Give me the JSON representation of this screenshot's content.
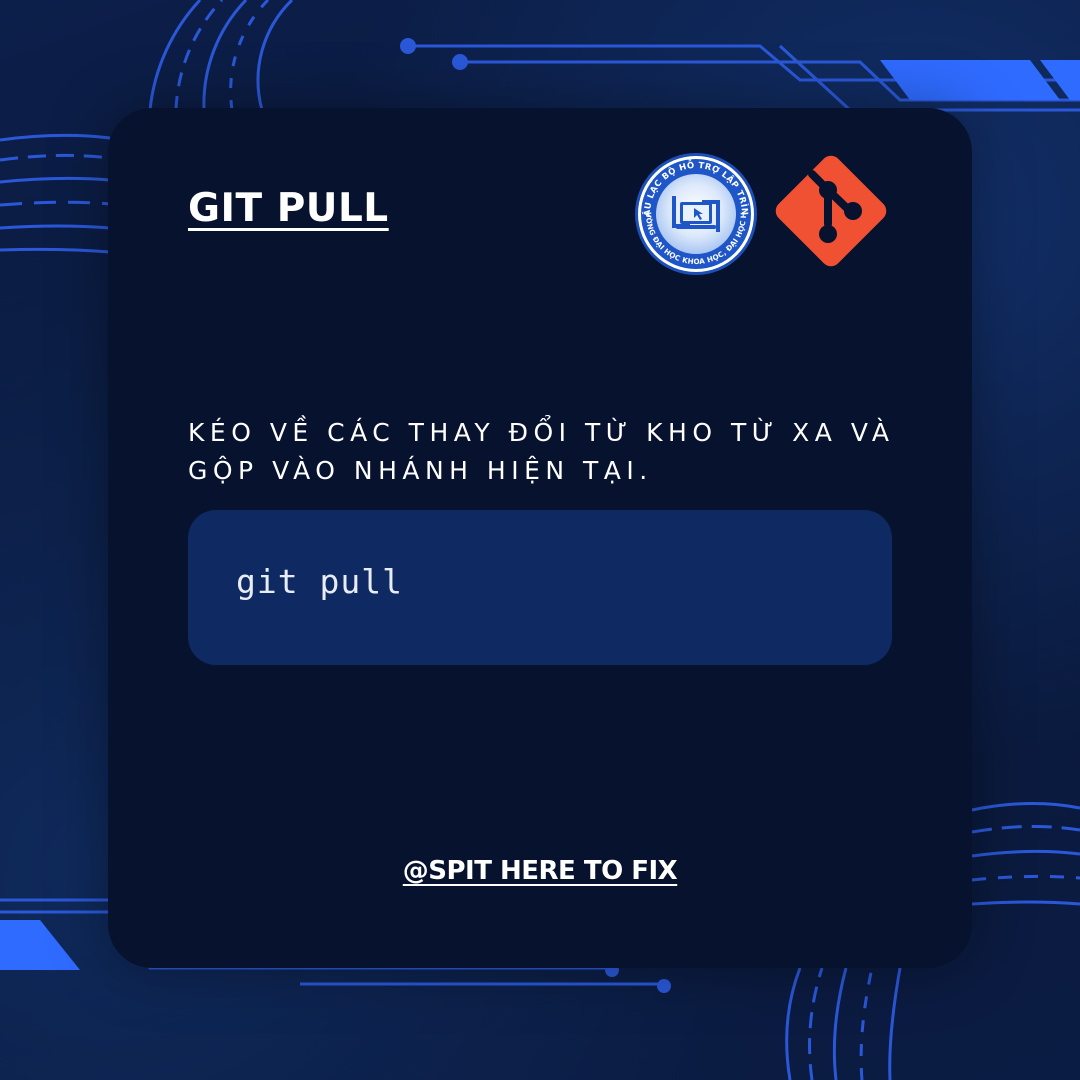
{
  "card": {
    "title": "GIT PULL",
    "description": "KÉO VỀ CÁC THAY ĐỔI TỪ KHO TỪ XA VÀ GỘP VÀO NHÁNH HIỆN TẠI.",
    "command": "git pull",
    "footer_handle": "@SPIT HERE TO FIX"
  },
  "logos": {
    "club": {
      "ring_text_top": "CÂU LẠC BỘ HỖ TRỢ LẬP TRÌNH",
      "ring_text_bottom": "TRƯỜNG ĐẠI HỌC KHOA HỌC, ĐẠI HỌC HUẾ",
      "icon": "laptop-cursor-icon"
    },
    "git": {
      "icon": "git-logo-icon",
      "color": "#f05133"
    }
  },
  "colors": {
    "background": "#0a1a3f",
    "card": "#07122e",
    "code_box": "#0f2a62",
    "accent_blue": "#2f6bff",
    "text": "#ffffff"
  }
}
